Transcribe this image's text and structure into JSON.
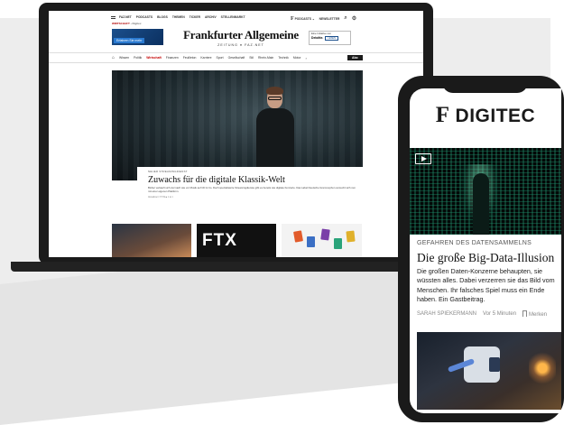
{
  "laptop": {
    "topnav": {
      "links": [
        "FAZ.NET",
        "PODCASTS",
        "BLOGS",
        "THEMEN",
        "TICKER",
        "ARCHIV",
        "STELLENMARKT"
      ],
      "podcasts_label": "PODCASTS",
      "newsletter_label": "NEWSLETTER",
      "breadcrumb_section": "WIRTSCHAFT",
      "breadcrumb_current": "Digitec",
      "anzeige": "ANZEIGE"
    },
    "ad_left": {
      "button": "Erfahren Sie mehr"
    },
    "masthead": {
      "name": "Frankfurter Allgemeine",
      "sub": "ZEITUNG  ●  FAZ.NET"
    },
    "ad_right": {
      "line1": "Eine Initiative von",
      "logo": "Deloitte.",
      "button": "LESEN"
    },
    "sections": [
      "Wissen",
      "Politik",
      "Wirtschaft",
      "Finanzen",
      "Feuilleton",
      "Karriere",
      "Sport",
      "Gesellschaft",
      "Stil",
      "Rhein-Main",
      "Technik",
      "Motor"
    ],
    "active_section": "Wirtschaft",
    "abo_label": "Abo",
    "teaser": {
      "kicker": "NEUER STREAMINGDIENST",
      "title": "Zuwachs für die digitale Klassik-Welt",
      "text": "Bisher verkauft sich viel nach wie vor Musik auf CD & Co. Doch spezialisierte Streamingdienste gibt es bereits wie digitale Konzerte. Das Label Deutsche Grammophon versucht sich nun mit einer eigenen Plattform.",
      "meta": "Aktualisiert 7/7/19  ■ 1  ⊕ 1"
    },
    "thumb2_text": "FTX"
  },
  "phone": {
    "brand": "DIGITEC",
    "brand_f": "F",
    "kicker": "GEFAHREN DES DATENSAMMELNS",
    "title": "Die große Big-Data-Illusion",
    "text": "Die großen Daten-Konzerne behaupten, sie wüssten alles. Dabei verzerren sie das Bild vom Menschen. Ihr falsches Spiel muss ein Ende haben. Ein Gastbeitrag.",
    "author": "SARAH SPIEKERMANN",
    "time": "Vor 5 Minuten",
    "bookmark": "Merken"
  },
  "colors": {
    "accent_red": "#c40000",
    "frame": "#1a1a1a"
  }
}
